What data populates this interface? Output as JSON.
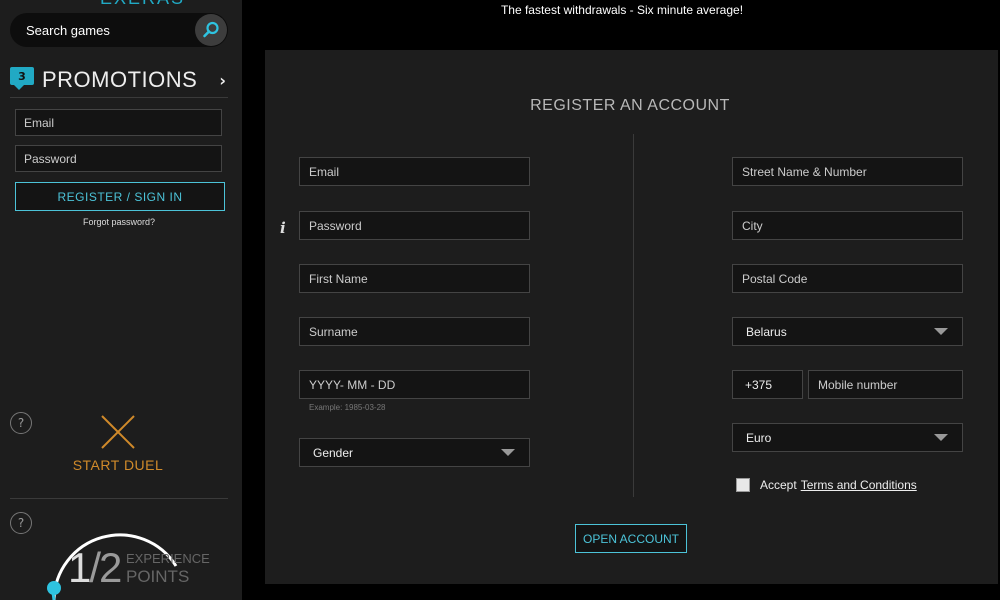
{
  "sidebar": {
    "brand_peek": "EXERAS",
    "search": {
      "placeholder": "Search games"
    },
    "promotions": {
      "count": "3",
      "label": "PROMOTIONS",
      "chevron": "›"
    },
    "login": {
      "email_placeholder": "Email",
      "password_placeholder": "Password",
      "register_label": "REGISTER / SIGN IN",
      "forgot_label": "Forgot password?"
    },
    "duel": {
      "help": "?",
      "label": "START DUEL"
    },
    "experience": {
      "help": "?",
      "current": "1",
      "separator": "/",
      "total": "2",
      "caption_line1": "EXPERIENCE",
      "caption_line2": "POINTS"
    }
  },
  "banner": "The fastest withdrawals - Six minute average!",
  "register": {
    "title": "REGISTER AN ACCOUNT",
    "left": {
      "email_placeholder": "Email",
      "password_placeholder": "Password",
      "password_info": "i",
      "first_name_placeholder": "First Name",
      "surname_placeholder": "Surname",
      "dob_placeholder": "YYYY- MM - DD",
      "dob_example": "Example: 1985-03-28",
      "gender_value": "Gender"
    },
    "right": {
      "street_placeholder": "Street Name & Number",
      "city_placeholder": "City",
      "postal_placeholder": "Postal Code",
      "country_value": "Belarus",
      "phone_code_value": "+375",
      "mobile_placeholder": "Mobile number",
      "currency_value": "Euro",
      "accept_text": "Accept",
      "terms_link": "Terms and Conditions"
    },
    "submit_label": "OPEN ACCOUNT"
  },
  "colors": {
    "accent": "#4cc3d8",
    "duel": "#d08a2a",
    "panel": "#1d1d1d",
    "background": "#000000"
  }
}
